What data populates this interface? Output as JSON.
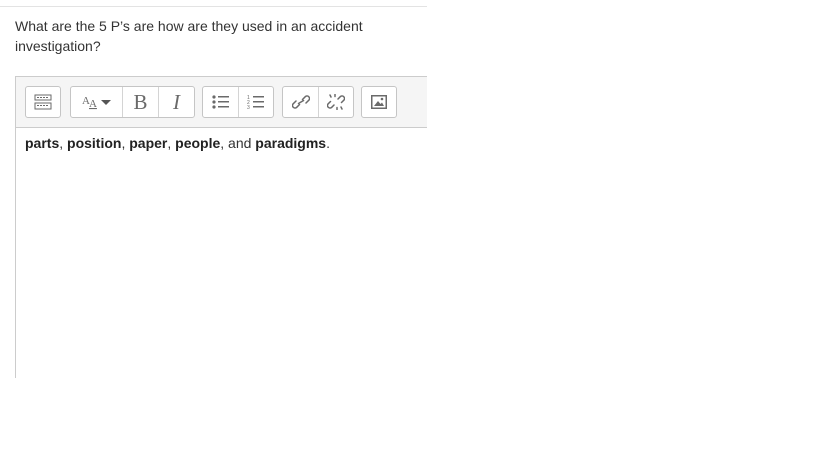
{
  "question": {
    "text": "What are the 5 P’s are how are they used in an accident investigation?"
  },
  "toolbar": {
    "buttons": [
      {
        "icon": "toolbar-toggle-icon"
      },
      {
        "icon": "font-size-icon"
      },
      {
        "icon": "bold-icon",
        "glyph": "B"
      },
      {
        "icon": "italic-icon",
        "glyph": "I"
      },
      {
        "icon": "bullet-list-icon"
      },
      {
        "icon": "numbered-list-icon"
      },
      {
        "icon": "link-icon"
      },
      {
        "icon": "unlink-icon"
      },
      {
        "icon": "image-icon"
      }
    ]
  },
  "answer": {
    "segments": [
      {
        "text": "parts",
        "bold": true
      },
      {
        "text": ", ",
        "bold": false
      },
      {
        "text": "position",
        "bold": true
      },
      {
        "text": ", ",
        "bold": false
      },
      {
        "text": "paper",
        "bold": true
      },
      {
        "text": ", ",
        "bold": false
      },
      {
        "text": "people",
        "bold": true
      },
      {
        "text": ", and ",
        "bold": false
      },
      {
        "text": "paradigms",
        "bold": true
      },
      {
        "text": ".",
        "bold": false
      }
    ]
  },
  "colors": {
    "toolbar_bg": "#f5f5f5",
    "border": "#cccccc",
    "text": "#333333"
  }
}
